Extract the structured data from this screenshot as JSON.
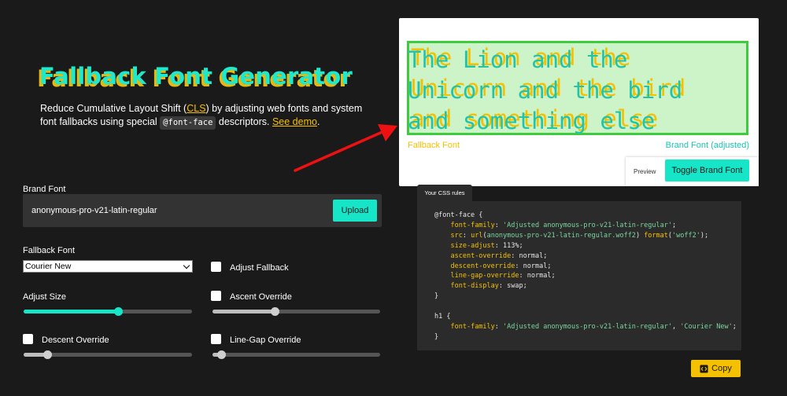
{
  "header": {
    "title": "Fallback Font Generator",
    "intro_before": "Reduce Cumulative Layout Shift (",
    "cls_link": "CLS",
    "intro_middle": ") by adjusting web fonts and system font fallbacks using special ",
    "code_chip": "@font-face",
    "intro_after": " descriptors. ",
    "demo_link": "See demo",
    "intro_end": "."
  },
  "preview": {
    "line1": "The Lion and the",
    "line2": "Unicorn and the bird",
    "line3": "and something else",
    "fallback_label": "Fallback Font",
    "brand_label": "Brand Font (adjusted)",
    "toolbar_label": "Preview",
    "toggle_label": "Toggle Brand Font"
  },
  "form": {
    "brand_font_label": "Brand Font",
    "brand_font_value": "anonymous-pro-v21-latin-regular",
    "upload_label": "Upload",
    "fallback_font_label": "Fallback Font",
    "fallback_font_selected": "Courier New",
    "adjust_fallback_label": "Adjust Fallback",
    "adjust_size_label": "Adjust Size",
    "ascent_override_label": "Ascent Override",
    "descent_override_label": "Descent Override",
    "line_gap_override_label": "Line-Gap Override",
    "sliders": {
      "adjust_size": 0.56,
      "ascent_override": 0.37,
      "descent_override": 0.14,
      "line_gap_override": 0.05
    }
  },
  "css_panel": {
    "tab_label": "Your CSS rules",
    "code": {
      "l1_sel": "@font-face {",
      "l2_prop": "font-family",
      "l2_val": "'Adjusted anonymous-pro-v21-latin-regular'",
      "l3_prop": "src",
      "l3_fn": "url",
      "l3_arg": "anonymous-pro-v21-latin-regular.woff2",
      "l3_fn2": "format",
      "l3_arg2": "'woff2'",
      "l4_prop": "size-adjust",
      "l4_val": "113%",
      "l5_prop": "ascent-override",
      "l5_val": "normal",
      "l6_prop": "descent-override",
      "l6_val": "normal",
      "l7_prop": "line-gap-override",
      "l7_val": "normal",
      "l8_prop": "font-display",
      "l8_val": "swap",
      "l9": "}",
      "l10_sel": "h1 {",
      "l11_prop": "font-family",
      "l11_val": "'Adjusted anonymous-pro-v21-latin-regular'",
      "l11_val2": "'Courier New'",
      "l12": "}"
    },
    "copy_label": "Copy"
  },
  "colors": {
    "accent_teal": "#17e5c8",
    "accent_yellow": "#f5c000",
    "background": "#1a1a1a",
    "arrow": "#ee1111"
  }
}
